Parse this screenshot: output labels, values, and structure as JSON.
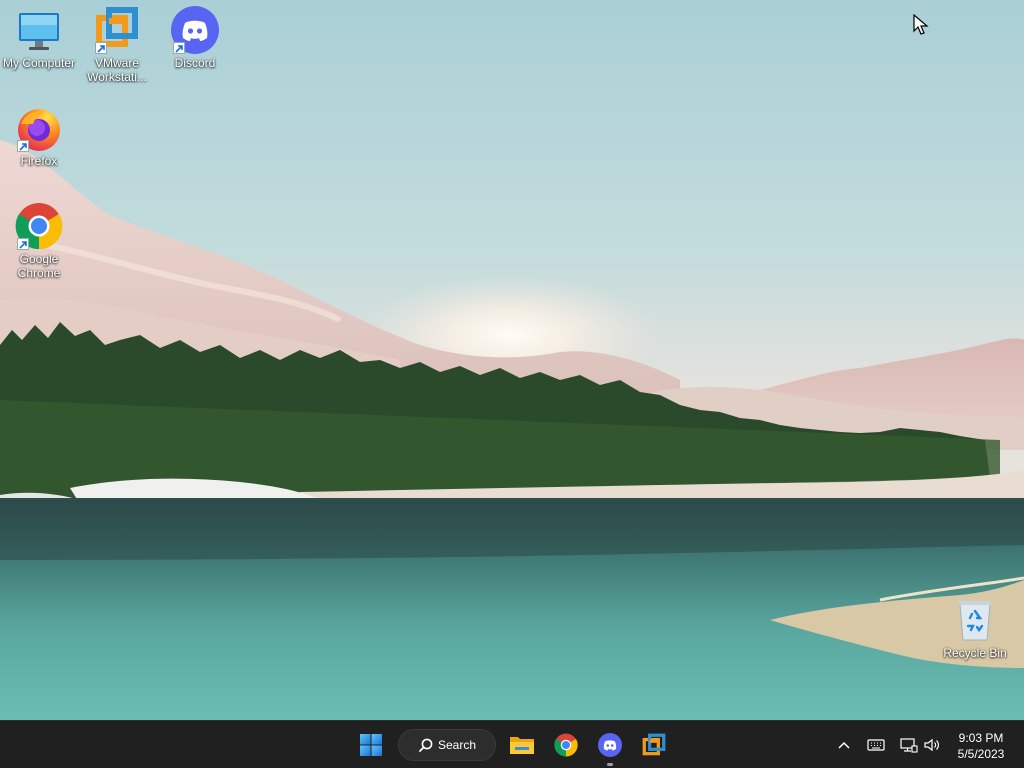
{
  "desktop": {
    "icons": [
      {
        "label": "My Computer",
        "icon": "monitor-icon"
      },
      {
        "label": "VMware\nWorkstati...",
        "icon": "vmware-icon"
      },
      {
        "label": "Discord",
        "icon": "discord-icon"
      },
      {
        "label": "Firefox",
        "icon": "firefox-icon"
      },
      {
        "label": "Google\nChrome",
        "icon": "chrome-icon"
      },
      {
        "label": "Recycle Bin",
        "icon": "recycle-bin-icon"
      }
    ]
  },
  "taskbar": {
    "start_icon": "windows-start-icon",
    "search_label": "Search",
    "pinned": [
      {
        "name": "File Explorer",
        "icon": "folder-icon"
      },
      {
        "name": "Google Chrome",
        "icon": "chrome-icon"
      },
      {
        "name": "Discord",
        "icon": "discord-icon",
        "running": true
      },
      {
        "name": "VMware Workstation",
        "icon": "vmware-icon"
      }
    ],
    "tray": {
      "icons": [
        "chevron-up-icon",
        "keyboard-icon",
        "network-icon",
        "speaker-icon"
      ],
      "time": "9:03 PM",
      "date": "5/5/2023"
    }
  },
  "colors": {
    "taskbar_bg": "#202020",
    "discord_blurple": "#5865F2",
    "windows_blue": "#3a9bdc"
  }
}
